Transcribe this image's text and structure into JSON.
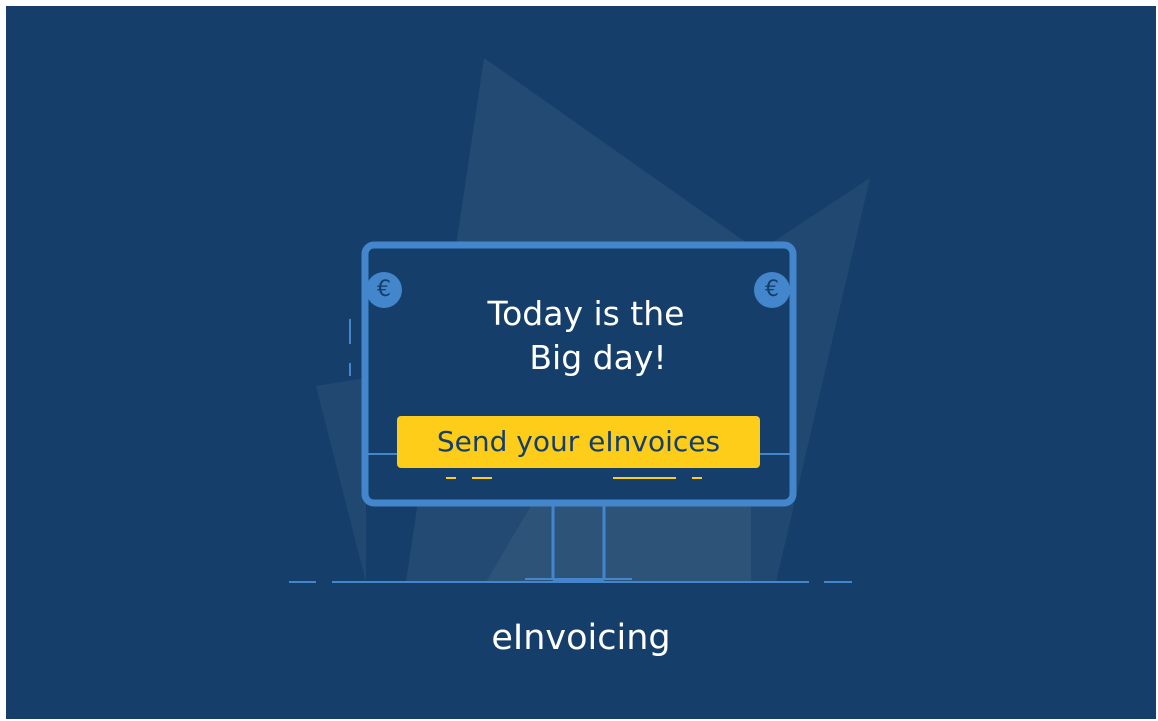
{
  "banner": {
    "headline_line1": "Today is the",
    "headline_line2": "Big day!",
    "cta_label": "Send your eInvoices",
    "euro_symbol": "€",
    "brand_label": "eInvoicing"
  },
  "colors": {
    "background": "#153f6a",
    "accent_yellow": "#fdcd19",
    "screen_blue": "#4486cc",
    "text": "#ffffff"
  },
  "icons": [
    "euro-coin-icon",
    "monitor-illustration"
  ]
}
